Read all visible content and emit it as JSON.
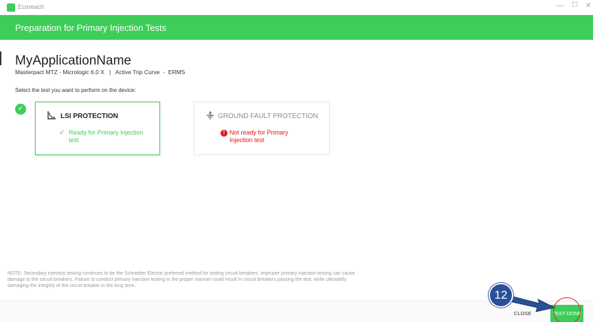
{
  "window": {
    "app_title": "Ecoreach",
    "minimize_glyph": "—",
    "maximize_glyph": "☐",
    "close_glyph": "✕"
  },
  "header": {
    "title": "Preparation for Primary Injection Tests"
  },
  "main": {
    "app_name": "MyApplicationName",
    "device_info": "Masterpact MTZ - Micrologic 6.0 X   |   Active Trip Curve  -  ERMS",
    "instruction": "Select the test you want to perform on the device:",
    "tests": [
      {
        "title": "LSI PROTECTION",
        "status": "Ready for Primary Injection test",
        "status_icon": "check-icon",
        "selected": true
      },
      {
        "title": "GROUND FAULT PROTECTION",
        "status": "Not ready for Primary Injection test",
        "status_icon": "error-icon",
        "selected": false
      }
    ],
    "note": "NOTE: Secondary injection testing continues to be the Schneider Electric preferred method for testing circuit breakers. Improper primary injection testing can cause damage to the circuit breakers. Failure to conduct primary injection testing in the proper manner could result in circuit breakers passing the test, while ultimately damaging the integrity of the circuit breaker in the long term."
  },
  "footer": {
    "close_label": "CLOSE",
    "test_done_label": "TEST DONE"
  },
  "annotation": {
    "step_number": "12"
  },
  "colors": {
    "accent": "#3dcd58",
    "error": "#e0151a",
    "annotation": "#2a4f96",
    "highlight": "#d9232d"
  }
}
